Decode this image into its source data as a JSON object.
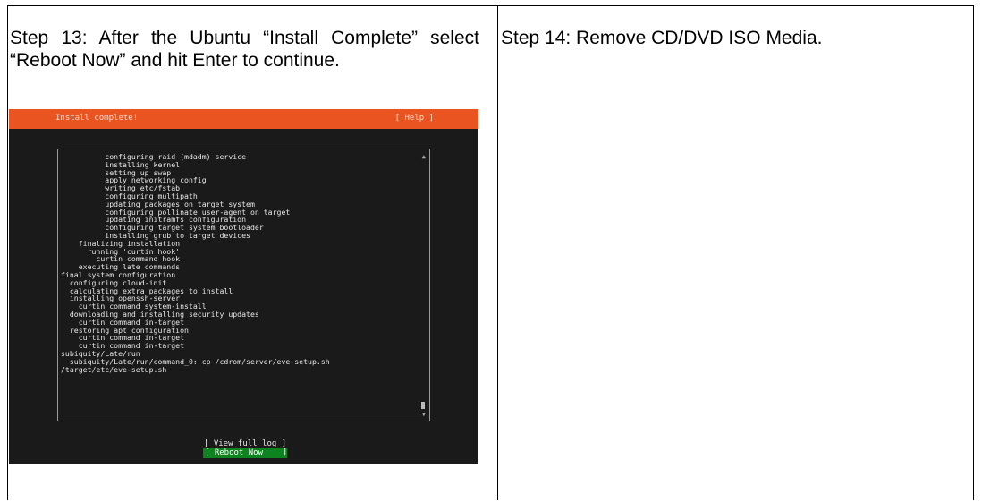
{
  "steps": [
    {
      "text": "Step 13: After the Ubuntu “Install Complete” select “Reboot Now” and hit Enter to continue."
    },
    {
      "text": "Step 14: Remove CD/DVD ISO Media."
    }
  ],
  "installer": {
    "title": "Install complete!",
    "help_label": "[ Help ]",
    "scroll_up": "▲",
    "scroll_down": "▼",
    "log_lines": [
      "          configuring raid (mdadm) service",
      "          installing kernel",
      "          setting up swap",
      "          apply networking config",
      "          writing etc/fstab",
      "          configuring multipath",
      "          updating packages on target system",
      "          configuring pollinate user-agent on target",
      "          updating initramfs configuration",
      "          configuring target system bootloader",
      "          installing grub to target devices",
      "    finalizing installation",
      "      running 'curtin hook'",
      "        curtin command hook",
      "    executing late commands",
      "final system configuration",
      "  configuring cloud-init",
      "  calculating extra packages to install",
      "  installing openssh-server",
      "    curtin command system-install",
      "  downloading and installing security updates",
      "    curtin command in-target",
      "  restoring apt configuration",
      "    curtin command in-target",
      "    curtin command in-target",
      "subiquity/Late/run",
      "  subiquity/Late/run/command_0: cp /cdrom/server/eve-setup.sh",
      "/target/etc/eve-setup.sh"
    ],
    "view_log_label": "[ View full log ]",
    "reboot_label": "[ Reboot Now    ]"
  }
}
